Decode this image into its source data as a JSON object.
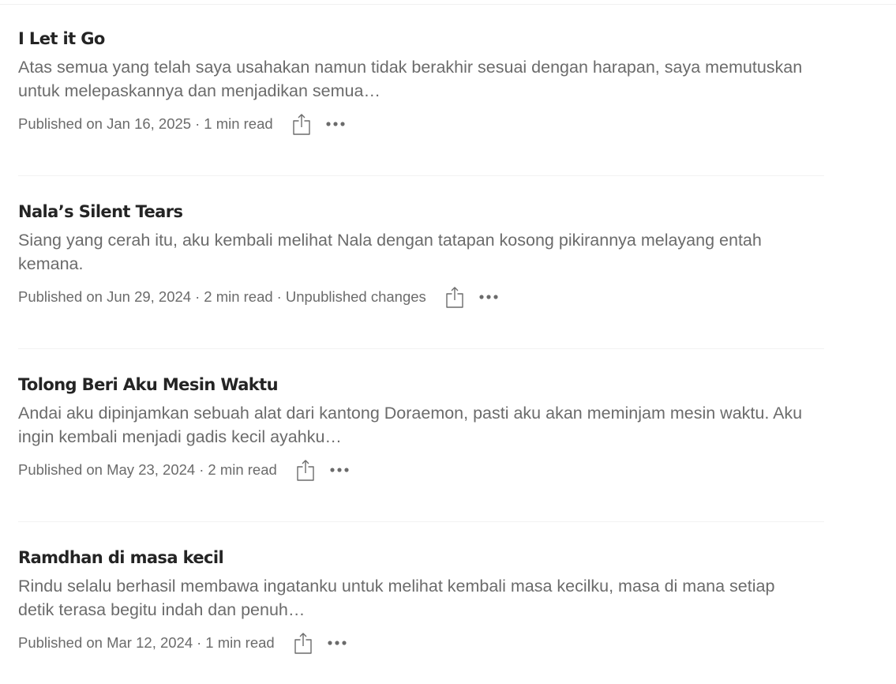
{
  "stories": [
    {
      "title": "I Let it Go",
      "snippet": "Atas semua yang telah saya usahakan namun tidak berakhir sesuai dengan harapan, saya memutuskan untuk melepaskannya dan menjadikan semua…",
      "published": "Published on Jan 16, 2025",
      "read_time": "1 min read",
      "extra": ""
    },
    {
      "title": "Nala’s Silent Tears",
      "snippet": "Siang yang cerah itu, aku kembali melihat Nala dengan tatapan kosong pikirannya melayang entah kemana.",
      "published": "Published on Jun 29, 2024",
      "read_time": "2 min read",
      "extra": "Unpublished changes"
    },
    {
      "title": "Tolong Beri Aku Mesin Waktu",
      "snippet": "Andai aku dipinjamkan sebuah alat dari kantong Doraemon, pasti aku akan meminjam mesin waktu. Aku ingin kembali menjadi gadis kecil ayahku…",
      "published": "Published on May 23, 2024",
      "read_time": "2 min read",
      "extra": ""
    },
    {
      "title": "Ramdhan di masa kecil",
      "snippet": "Rindu selalu berhasil membawa ingatanku untuk melihat kembali masa kecilku, masa di mana setiap detik terasa begitu indah dan penuh…",
      "published": "Published on Mar 12, 2024",
      "read_time": "1 min read",
      "extra": ""
    }
  ],
  "meta_separator": "·",
  "icons": {
    "share": "share-icon",
    "more": "more-options-icon"
  },
  "colors": {
    "title": "#242424",
    "muted": "#6b6b6b",
    "divider": "#f2f2f2"
  }
}
